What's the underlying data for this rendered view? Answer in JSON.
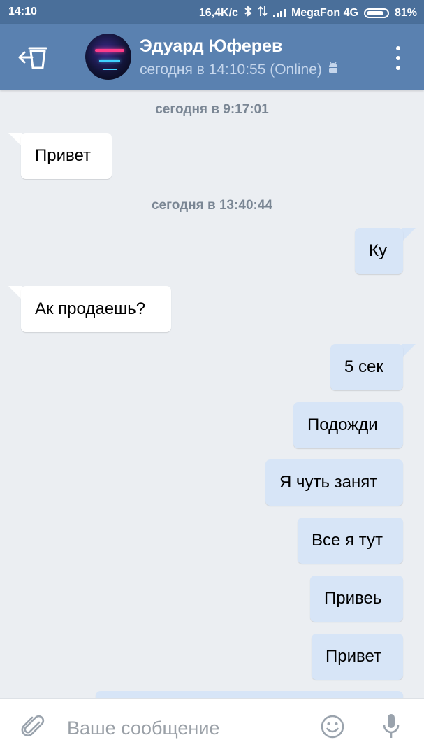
{
  "status_bar": {
    "time": "14:10",
    "speed": "16,4K/c",
    "carrier": "MegaFon 4G",
    "battery": "81%"
  },
  "header": {
    "name": "Эдуард Юферев",
    "status": "сегодня в 14:10:55 (Online)"
  },
  "chat": {
    "separators": [
      "сегодня в 9:17:01",
      "сегодня в 13:40:44"
    ],
    "messages": [
      {
        "direction": "incoming",
        "text": "Привет"
      },
      {
        "direction": "outgoing",
        "text": "Ку"
      },
      {
        "direction": "incoming",
        "text": "Ак продаешь?"
      },
      {
        "direction": "outgoing",
        "text": "5 сек"
      },
      {
        "direction": "outgoing",
        "text": "Подожди"
      },
      {
        "direction": "outgoing",
        "text": "Я чуть занят"
      },
      {
        "direction": "outgoing",
        "text": "Все я тут"
      },
      {
        "direction": "outgoing",
        "text": "Привеь"
      },
      {
        "direction": "outgoing",
        "text": "Привет"
      }
    ]
  },
  "input": {
    "placeholder": "Ваше сообщение"
  },
  "colors": {
    "status_bar": "#4a6f9a",
    "header": "#5a81b0",
    "background": "#ebeef2",
    "incoming_bubble": "#ffffff",
    "outgoing_bubble": "#d7e5f7"
  }
}
